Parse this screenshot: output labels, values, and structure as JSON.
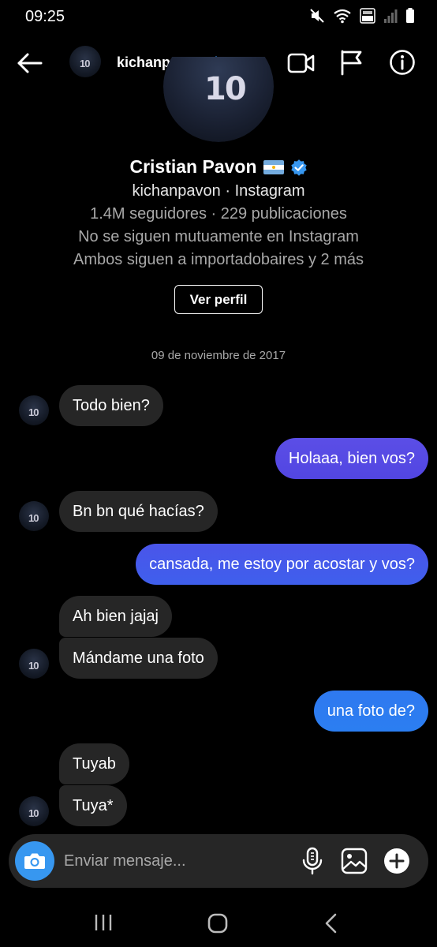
{
  "status_bar": {
    "time": "09:25",
    "icons": [
      "mute-icon",
      "wifi-icon",
      "volte-4g-icon",
      "signal-icon",
      "battery-icon"
    ]
  },
  "header": {
    "username": "kichanpavon",
    "verified": true,
    "icons": [
      "back-arrow-icon",
      "video-call-icon",
      "flag-icon",
      "info-icon"
    ]
  },
  "profile": {
    "jersey_number": "10",
    "display_name": "Cristian Pavon",
    "handle_line": "kichanpavon · Instagram",
    "stats_line": "1.4M seguidores · 229 publicaciones",
    "follow_line": "No se siguen mutuamente en Instagram",
    "mutual_line": "Ambos siguen a importadobaires y 2 más",
    "view_profile_label": "Ver perfil"
  },
  "conversation": {
    "date_label": "09 de noviembre de 2017",
    "messages": [
      {
        "from": "them",
        "text": "Todo bien?"
      },
      {
        "from": "me",
        "text": "Holaaa, bien vos?"
      },
      {
        "from": "them",
        "text": "Bn bn qué hacías?"
      },
      {
        "from": "me",
        "text": "cansada, me estoy por acostar y vos?"
      },
      {
        "from": "them",
        "text": "Ah bien jajaj"
      },
      {
        "from": "them",
        "text": "Mándame una foto"
      },
      {
        "from": "me",
        "text": "una foto de?"
      },
      {
        "from": "them",
        "text": "Tuyab"
      },
      {
        "from": "them",
        "text": "Tuya*"
      }
    ]
  },
  "composer": {
    "placeholder": "Enviar mensaje...",
    "icons": [
      "camera-icon",
      "microphone-icon",
      "gallery-icon",
      "plus-icon"
    ]
  },
  "colors": {
    "background": "#000000",
    "incoming_bubble": "#262626",
    "outgoing_gradient_top": "#5b4ee6",
    "outgoing_gradient_bottom": "#2f7bf0",
    "verified_badge": "#3797f0",
    "camera_button": "#3797f0"
  }
}
